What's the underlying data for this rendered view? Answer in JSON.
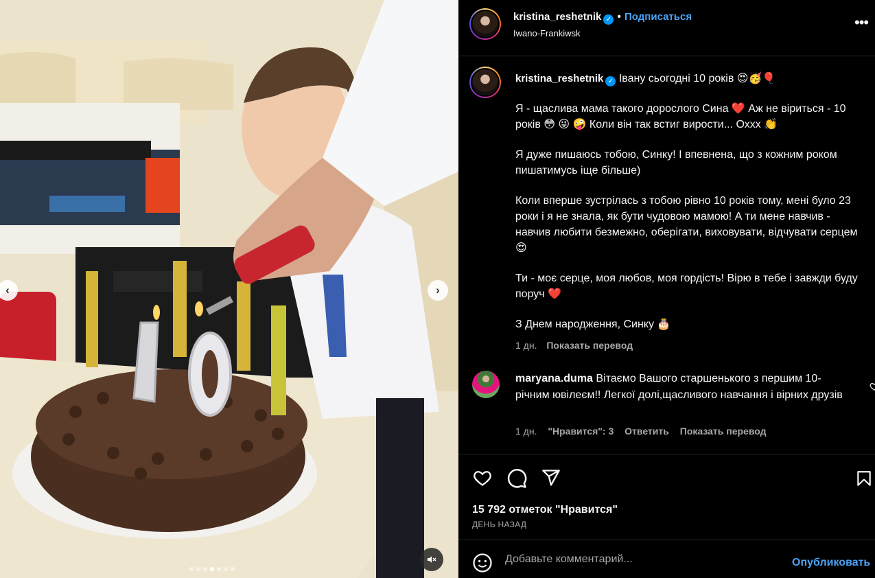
{
  "post": {
    "username": "kristina_reshetnik",
    "verified_icon": "verified-badge-icon",
    "follow_label": "Подписаться",
    "separator": "•",
    "location": "Iwano-Frankiwsk",
    "more_icon": "more-options-icon",
    "more_glyph": "•••"
  },
  "media": {
    "prev_glyph": "‹",
    "next_glyph": "›",
    "dots_count": 7,
    "active_dot": 3
  },
  "caption": {
    "username": "kristina_reshetnik",
    "first_line": "Івану сьогодні 10 років 😍🥳🎈",
    "paragraphs": [
      "Я - щаслива мама такого дорослого Сина ❤️  Аж не віриться - 10 років 😳 😜 🤪  Коли він так встиг вирости... Охxx 👏",
      "Я дуже пишаюсь тобою, Синку! І впевнена, що з кожним роком пишатимусь іще більше)",
      "Коли вперше зустрілась з тобою рівно 10 років тому, мені було 23 роки і я не знала, як бути чудовою мамою! А ти мене навчив - навчив любити безмежно, оберігати, виховувати, відчувати серцем 😍",
      "Ти - моє серце, моя любов, моя гордість! Вірю в тебе і завжди буду поруч ❤️",
      "З Днем народження, Синку 🎂"
    ],
    "time": "1 дн.",
    "translate_label": "Показать перевод"
  },
  "comment": {
    "username": "maryana.duma",
    "text": "Вітаємо Вашого старшенького з першим 10-річним ювілеєм!! Легкої долі,щасливого навчання і вірних друзів",
    "time": "1 дн.",
    "likes_label": "\"Нравится\": 3",
    "reply_label": "Ответить",
    "translate_label": "Показать перевод"
  },
  "actions": {
    "likes_text": "15 792 отметок \"Нравится\"",
    "date_text": "ДЕНЬ НАЗАД"
  },
  "add_comment": {
    "placeholder": "Добавьте комментарий...",
    "publish_label": "Опубликовать"
  },
  "colors": {
    "background": "#000000",
    "text": "#f5f5f5",
    "secondary": "#a8a8a8",
    "link": "#4aa3f5",
    "divider": "#262626"
  }
}
